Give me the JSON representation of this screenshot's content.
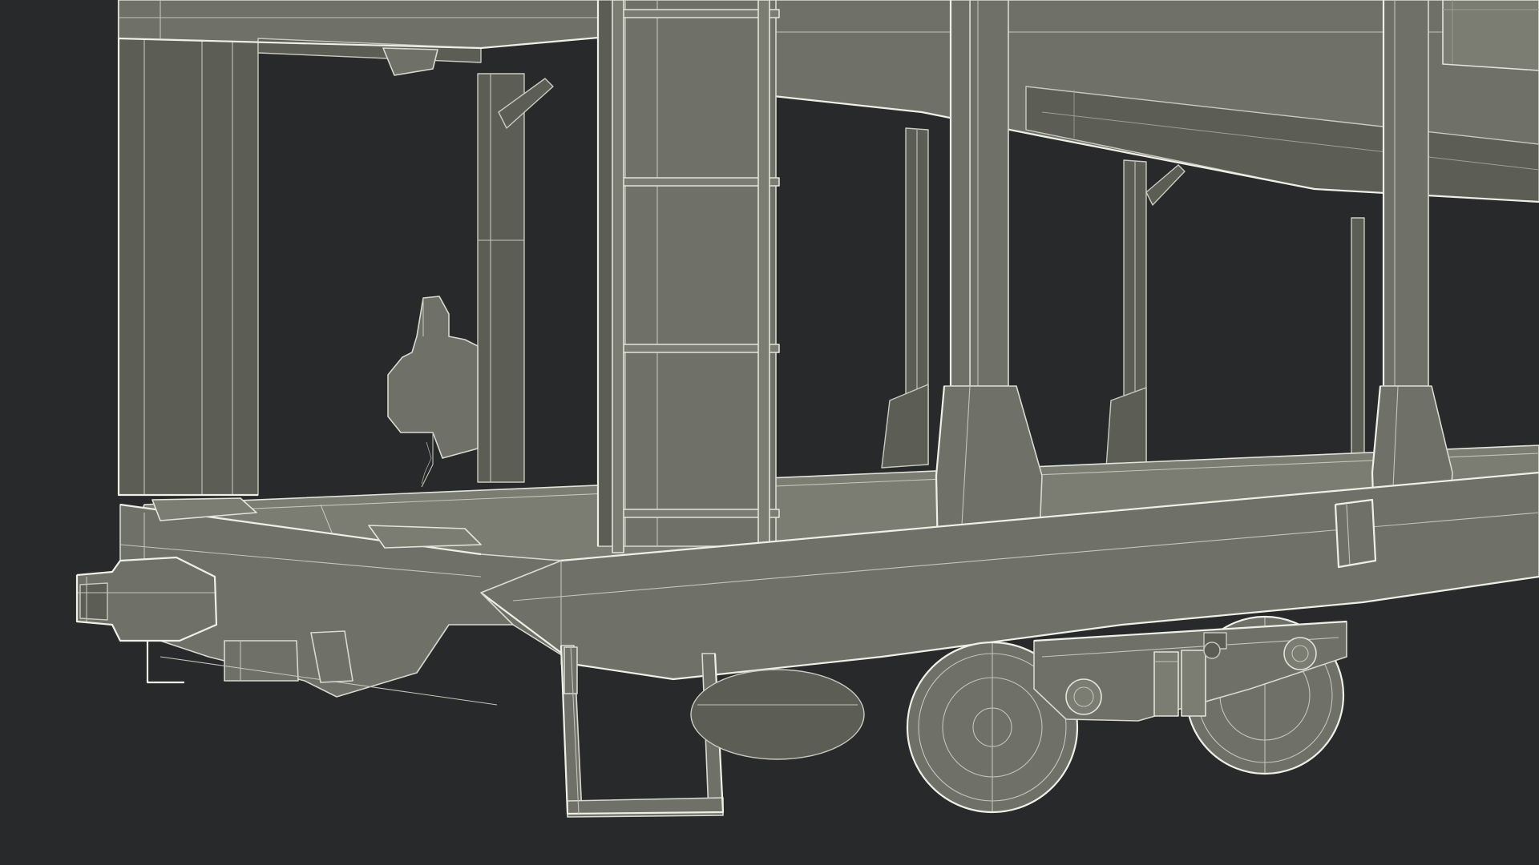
{
  "scene": {
    "subject": "autorack-railcar-wireframe",
    "colors": {
      "background": "#28292a",
      "surface": "#6f7067",
      "surface_dark": "#5c5d55",
      "wire": "#c4c5ba",
      "edge": "#eeefe5"
    }
  }
}
